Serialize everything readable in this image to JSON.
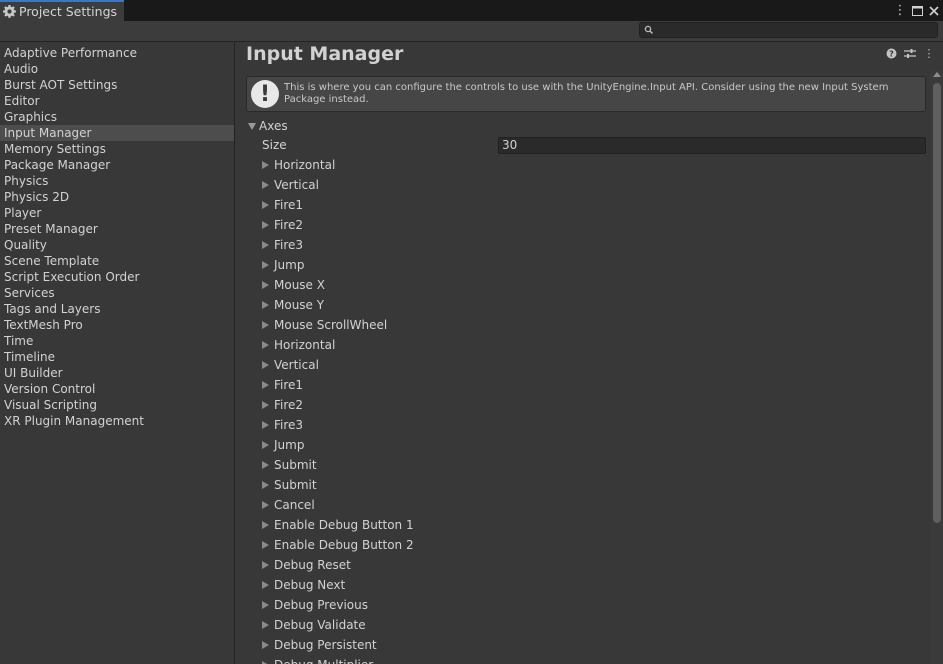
{
  "window": {
    "tab_title": "Project Settings",
    "controls": [
      "menu-icon",
      "maximize-icon",
      "close-icon"
    ]
  },
  "search": {
    "placeholder": "",
    "value": ""
  },
  "sidebar": {
    "items": [
      {
        "label": "Adaptive Performance"
      },
      {
        "label": "Audio"
      },
      {
        "label": "Burst AOT Settings"
      },
      {
        "label": "Editor"
      },
      {
        "label": "Graphics"
      },
      {
        "label": "Input Manager",
        "selected": true
      },
      {
        "label": "Memory Settings"
      },
      {
        "label": "Package Manager"
      },
      {
        "label": "Physics"
      },
      {
        "label": "Physics 2D"
      },
      {
        "label": "Player"
      },
      {
        "label": "Preset Manager"
      },
      {
        "label": "Quality"
      },
      {
        "label": "Scene Template"
      },
      {
        "label": "Script Execution Order"
      },
      {
        "label": "Services"
      },
      {
        "label": "Tags and Layers"
      },
      {
        "label": "TextMesh Pro"
      },
      {
        "label": "Time"
      },
      {
        "label": "Timeline"
      },
      {
        "label": "UI Builder"
      },
      {
        "label": "Version Control"
      },
      {
        "label": "Visual Scripting"
      },
      {
        "label": "XR Plugin Management"
      }
    ]
  },
  "main": {
    "title": "Input Manager",
    "header_icons": [
      "help-icon",
      "preset-icon",
      "more-icon"
    ],
    "help_text": "This is where you can configure the controls to use with the UnityEngine.Input API. Consider using the new Input System Package instead.",
    "axes_label": "Axes",
    "size_label": "Size",
    "size_value": "30",
    "axes": [
      "Horizontal",
      "Vertical",
      "Fire1",
      "Fire2",
      "Fire3",
      "Jump",
      "Mouse X",
      "Mouse Y",
      "Mouse ScrollWheel",
      "Horizontal",
      "Vertical",
      "Fire1",
      "Fire2",
      "Fire3",
      "Jump",
      "Submit",
      "Submit",
      "Cancel",
      "Enable Debug Button 1",
      "Enable Debug Button 2",
      "Debug Reset",
      "Debug Next",
      "Debug Previous",
      "Debug Validate",
      "Debug Persistent",
      "Debug Multiplier"
    ]
  },
  "colors": {
    "background": "#383838",
    "titlebar": "#191919",
    "tab_accent": "#3a79bb",
    "selected_item": "#4d4d4d",
    "text": "#d2d2d2"
  }
}
